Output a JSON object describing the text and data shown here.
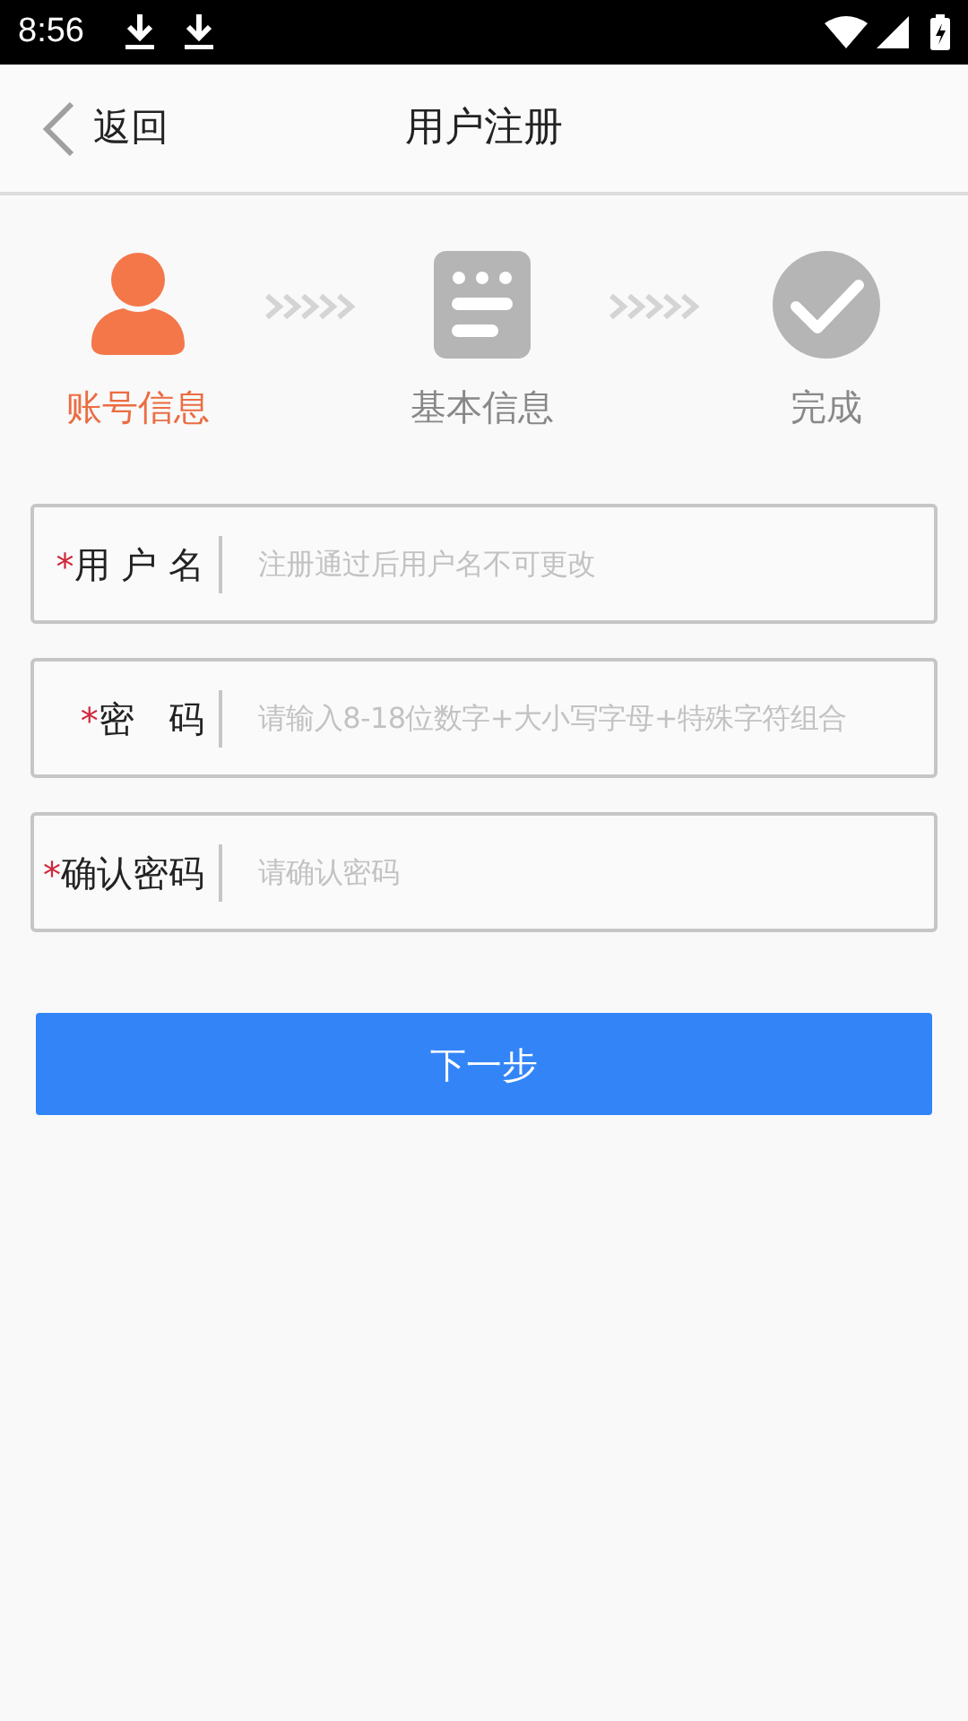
{
  "status_bar": {
    "time": "8:56"
  },
  "header": {
    "back_label": "返回",
    "title": "用户注册"
  },
  "steps": [
    {
      "kind": "person",
      "label": "账号信息",
      "selected": true
    },
    {
      "kind": "form",
      "label": "基本信息",
      "selected": false
    },
    {
      "kind": "check",
      "label": "完成",
      "selected": false
    }
  ],
  "fields": [
    {
      "required_mark": "*",
      "label": "用 户 名",
      "placeholder": "注册通过后用户名不可更改"
    },
    {
      "required_mark": "*",
      "label": "密   码",
      "placeholder": "请输入8-18位数字+大小写字母+特殊字符组合"
    },
    {
      "required_mark": "*",
      "label": "确认密码",
      "placeholder": "请确认密码"
    }
  ],
  "next_button": "下一步"
}
